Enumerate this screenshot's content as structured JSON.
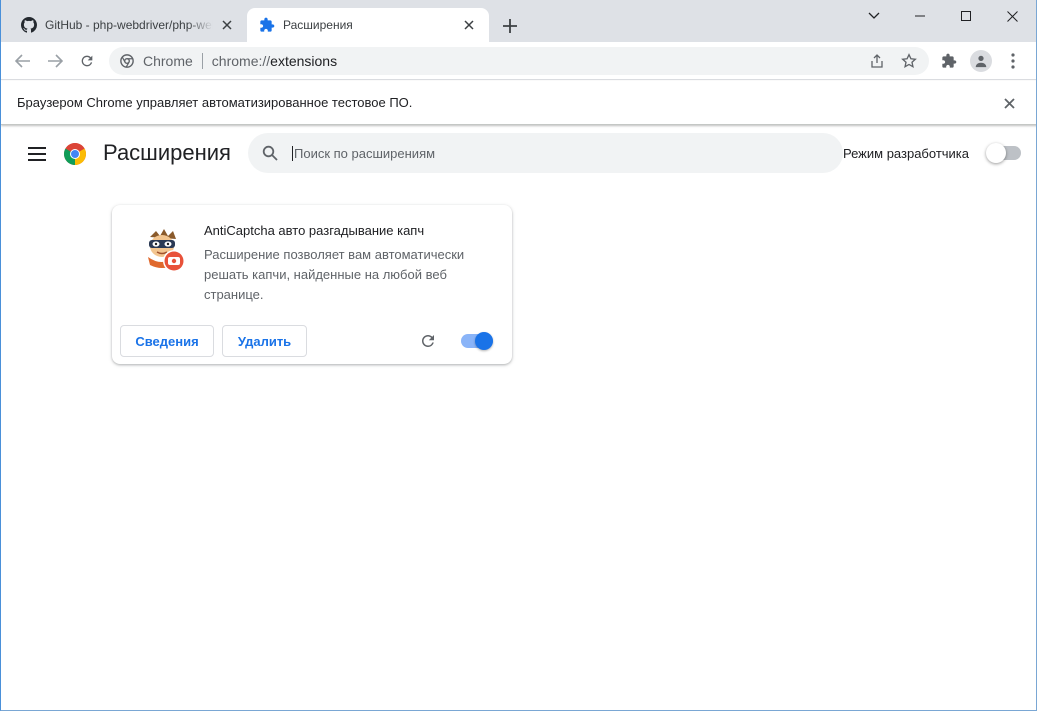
{
  "colors": {
    "accent": "#1a73e8",
    "tabstrip_bg": "#dee1e6",
    "omnibox_bg": "#f1f3f4",
    "text_primary": "#202124",
    "text_secondary": "#5f6368"
  },
  "tabs": [
    {
      "title": "GitHub - php-webdriver/php-webdriver",
      "icon": "github-icon",
      "active": false
    },
    {
      "title": "Расширения",
      "icon": "puzzle-icon",
      "active": true
    }
  ],
  "omnibox": {
    "chip": "Chrome",
    "url_scheme": "chrome://",
    "url_path": "extensions"
  },
  "infobar": {
    "message": "Браузером Chrome управляет автоматизированное тестовое ПО."
  },
  "page": {
    "title": "Расширения",
    "search_placeholder": "Поиск по расширениям",
    "dev_mode_label": "Режим разработчика",
    "dev_mode_enabled": false
  },
  "extension": {
    "name": "AntiCaptcha авто разгадывание капч",
    "description": "Расширение позволяет вам автоматически решать капчи, найденные на любой веб странице.",
    "details_label": "Сведения",
    "remove_label": "Удалить",
    "enabled": true
  }
}
